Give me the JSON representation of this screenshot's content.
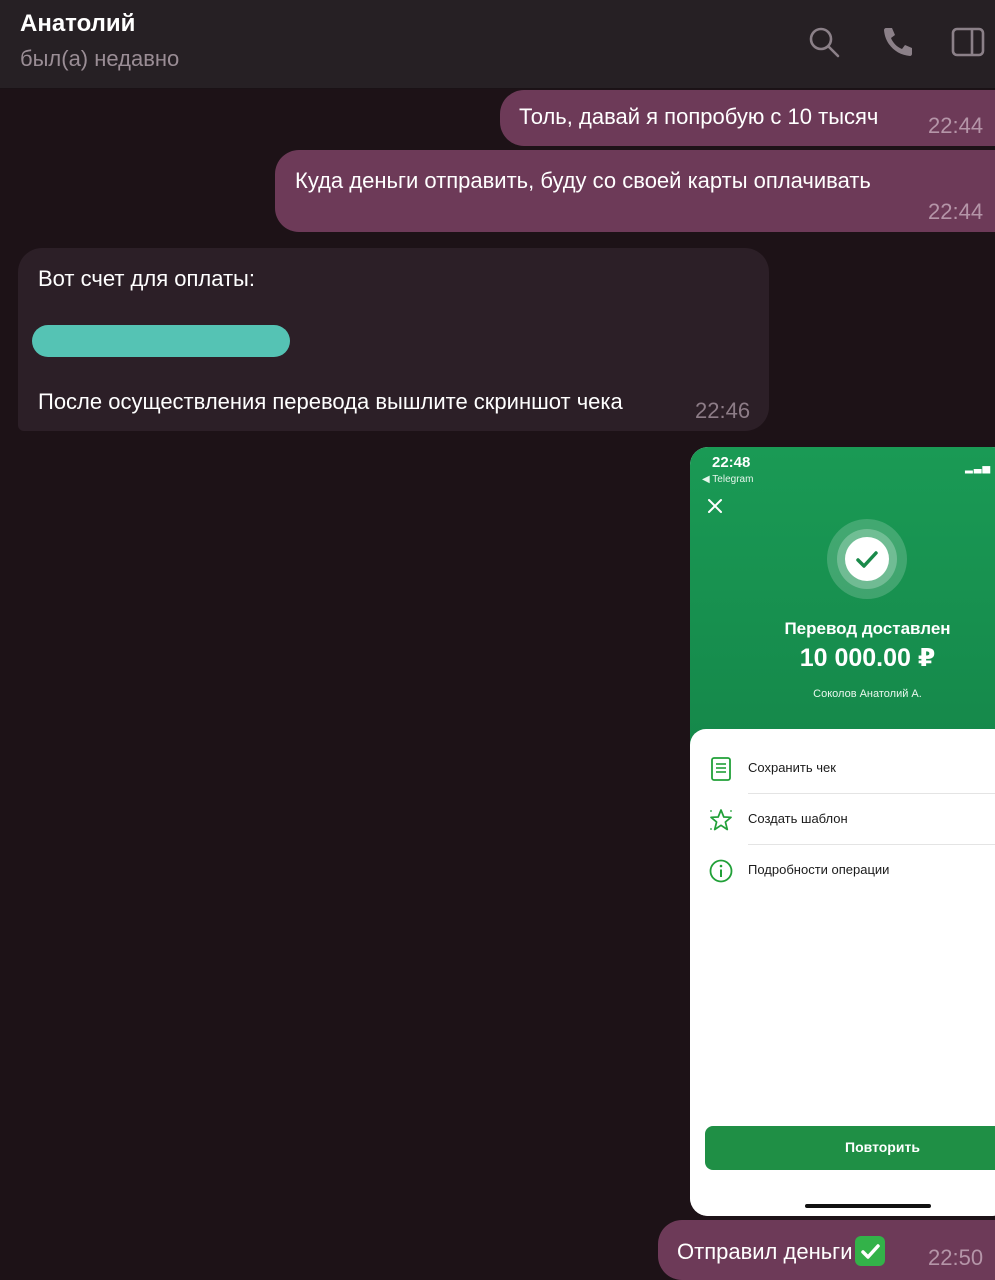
{
  "header": {
    "contact_name": "Анатолий",
    "status": "был(а) недавно",
    "icons": [
      "search-icon",
      "phone-icon",
      "sidebar-panel-icon"
    ]
  },
  "messages": [
    {
      "direction": "out",
      "text": "Толь, давай я попробую с 10 тысяч",
      "time": "22:44"
    },
    {
      "direction": "out",
      "text": "Куда деньги отправить, буду со своей карты оплачивать",
      "time": "22:44"
    },
    {
      "direction": "in",
      "title": "Вот счет для оплаты:",
      "redacted": true,
      "text": "После осуществления перевода вышлите скриншот чека",
      "time": "22:46"
    },
    {
      "direction": "out",
      "text": "Отправил деньги",
      "emoji": "check-mark-button",
      "time": "22:50"
    }
  ],
  "screenshot": {
    "status_time": "22:48",
    "back_label": "◀ Telegram",
    "signal": "LT",
    "title": "Перевод доставлен",
    "amount": "10 000.00 ₽",
    "recipient": "Соколов Анатолий А.",
    "actions": [
      "Сохранить чек",
      "Создать шаблон",
      "Подробности операции"
    ],
    "repeat_label": "Повторить",
    "colors": {
      "green_top": "#1a9a55",
      "green_button": "#1f8f45",
      "icon_green": "#21a038"
    }
  },
  "colors": {
    "background": "#1d1217",
    "outgoing_bubble": "#6d3a58",
    "incoming_bubble": "#2c1f27",
    "redaction": "#55c3b4"
  }
}
